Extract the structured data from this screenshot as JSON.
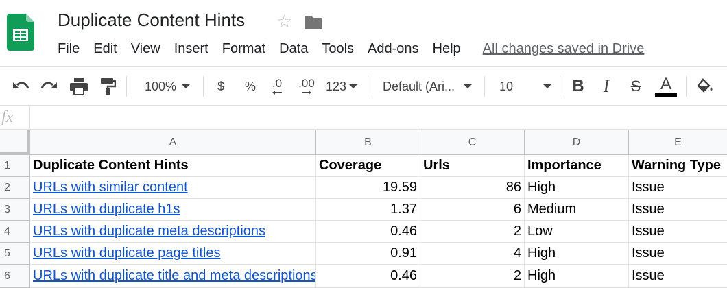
{
  "document": {
    "title": "Duplicate Content Hints",
    "save_status": "All changes saved in Drive"
  },
  "menu": [
    "File",
    "Edit",
    "View",
    "Insert",
    "Format",
    "Data",
    "Tools",
    "Add-ons",
    "Help"
  ],
  "toolbar": {
    "zoom": "100%",
    "currency": "$",
    "percent": "%",
    "decrease_decimal": ".0",
    "increase_decimal": ".00",
    "more_formats": "123",
    "font": "Default (Ari...",
    "font_size": "10",
    "text_color": "#000000"
  },
  "formula_bar": {
    "label": "fx",
    "value": ""
  },
  "columns": [
    "A",
    "B",
    "C",
    "D",
    "E"
  ],
  "rows": [
    "1",
    "2",
    "3",
    "4",
    "5",
    "6"
  ],
  "header_row": [
    "Duplicate Content Hints",
    "Coverage",
    "Urls",
    "Importance",
    "Warning Type"
  ],
  "data_rows": [
    {
      "hint": "URLs with similar content",
      "coverage": "19.59",
      "urls": "86",
      "importance": "High",
      "warning": "Issue"
    },
    {
      "hint": "URLs with duplicate h1s",
      "coverage": "1.37",
      "urls": "6",
      "importance": "Medium",
      "warning": "Issue"
    },
    {
      "hint": "URLs with duplicate meta descriptions",
      "coverage": "0.46",
      "urls": "2",
      "importance": "Low",
      "warning": "Issue"
    },
    {
      "hint": "URLs with duplicate page titles",
      "coverage": "0.91",
      "urls": "4",
      "importance": "High",
      "warning": "Issue"
    },
    {
      "hint": "URLs with duplicate title and meta descriptions",
      "coverage": "0.46",
      "urls": "2",
      "importance": "High",
      "warning": "Issue"
    }
  ],
  "colors": {
    "sheets_green": "#0f9d58",
    "link_blue": "#1155cc",
    "header_bg": "#f8f9fa"
  }
}
